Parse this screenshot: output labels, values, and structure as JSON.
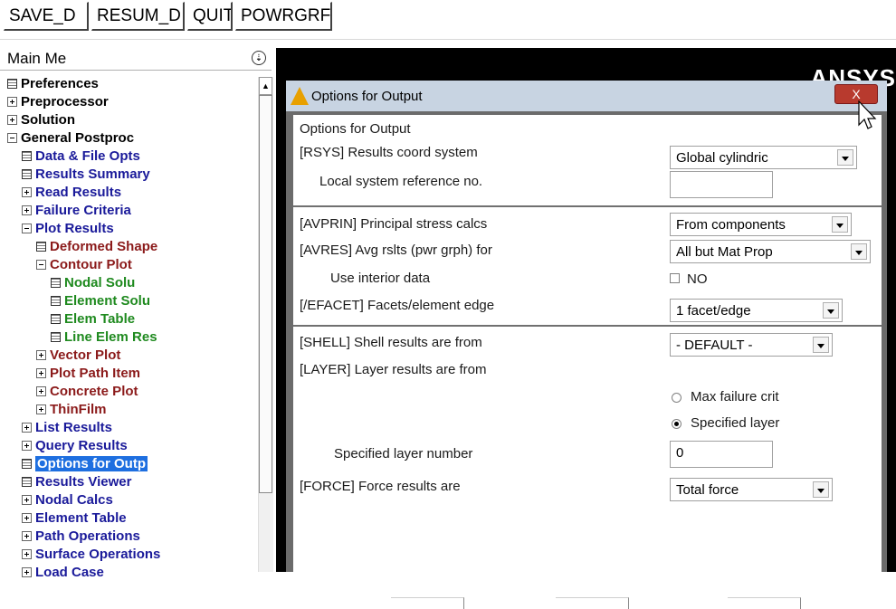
{
  "toolbar": {
    "buttons": [
      "SAVE_D",
      "RESUM_D",
      "QUIT",
      "POWRGRF"
    ]
  },
  "menu": {
    "title": "Main Me",
    "items": [
      {
        "label": "Preferences",
        "icon": "doc-icon",
        "color": "black"
      },
      {
        "label": "Preprocessor",
        "icon": "plus-icon",
        "color": "black"
      },
      {
        "label": "Solution",
        "icon": "plus-icon",
        "color": "black"
      },
      {
        "label": "General Postproc",
        "icon": "minus-icon",
        "color": "black"
      },
      {
        "label": "Data & File Opts",
        "icon": "doc-icon",
        "color": "blue"
      },
      {
        "label": "Results Summary",
        "icon": "doc-icon",
        "color": "blue"
      },
      {
        "label": "Read Results",
        "icon": "plus-icon",
        "color": "blue"
      },
      {
        "label": "Failure Criteria",
        "icon": "plus-icon",
        "color": "blue"
      },
      {
        "label": "Plot Results",
        "icon": "minus-icon",
        "color": "blue"
      },
      {
        "label": "Deformed Shape",
        "icon": "doc-icon",
        "color": "red"
      },
      {
        "label": "Contour Plot",
        "icon": "minus-icon",
        "color": "red"
      },
      {
        "label": "Nodal Solu",
        "icon": "doc-icon",
        "color": "green"
      },
      {
        "label": "Element Solu",
        "icon": "doc-icon",
        "color": "green"
      },
      {
        "label": "Elem Table",
        "icon": "doc-icon",
        "color": "green"
      },
      {
        "label": "Line Elem Res",
        "icon": "doc-icon",
        "color": "green"
      },
      {
        "label": "Vector Plot",
        "icon": "plus-icon",
        "color": "red"
      },
      {
        "label": "Plot Path Item",
        "icon": "plus-icon",
        "color": "red"
      },
      {
        "label": "Concrete Plot",
        "icon": "plus-icon",
        "color": "red"
      },
      {
        "label": "ThinFilm",
        "icon": "plus-icon",
        "color": "red"
      },
      {
        "label": "List Results",
        "icon": "plus-icon",
        "color": "blue"
      },
      {
        "label": "Query Results",
        "icon": "plus-icon",
        "color": "blue"
      },
      {
        "label": "Options for Outp",
        "icon": "doc-icon",
        "color": "blue",
        "selected": true
      },
      {
        "label": "Results Viewer",
        "icon": "doc-icon",
        "color": "blue"
      },
      {
        "label": "Nodal Calcs",
        "icon": "plus-icon",
        "color": "blue"
      },
      {
        "label": "Element Table",
        "icon": "plus-icon",
        "color": "blue"
      },
      {
        "label": "Path Operations",
        "icon": "plus-icon",
        "color": "blue"
      },
      {
        "label": "Surface Operations",
        "icon": "plus-icon",
        "color": "blue"
      },
      {
        "label": "Load Case",
        "icon": "plus-icon",
        "color": "blue"
      }
    ],
    "colors": {
      "black": "#000000",
      "blue": "#1a1a9a",
      "red": "#8b1a1a",
      "green": "#1f8a1f",
      "selected": "#1e6fe0"
    }
  },
  "graphics": {
    "logo": "ANSYS"
  },
  "dialog": {
    "title": "Options for Output",
    "close_label": "X",
    "heading": "Options for Output",
    "rsys": {
      "label": "[RSYS]  Results coord system",
      "value": "Global cylindric"
    },
    "local_ref": {
      "label": "Local system reference no.",
      "value": ""
    },
    "avprin": {
      "label": "[AVPRIN]  Principal stress calcs",
      "value": "From components"
    },
    "avres": {
      "label": "[AVRES]  Avg rslts (pwr grph) for",
      "value": "All but Mat Prop"
    },
    "interior": {
      "label": "Use interior data",
      "checkbox_label": "NO",
      "checked": false
    },
    "efacet": {
      "label": "[/EFACET]  Facets/element edge",
      "value": "1 facet/edge"
    },
    "shell": {
      "label": "[SHELL]  Shell results are from",
      "value": "- DEFAULT -"
    },
    "layer": {
      "label": "[LAYER]  Layer results are from",
      "options": [
        "Max failure crit",
        "Specified layer"
      ],
      "selected": "Specified layer"
    },
    "layer_number": {
      "label": "Specified layer number",
      "value": "0"
    },
    "force": {
      "label": "[FORCE]  Force results are",
      "value": "Total force"
    }
  }
}
